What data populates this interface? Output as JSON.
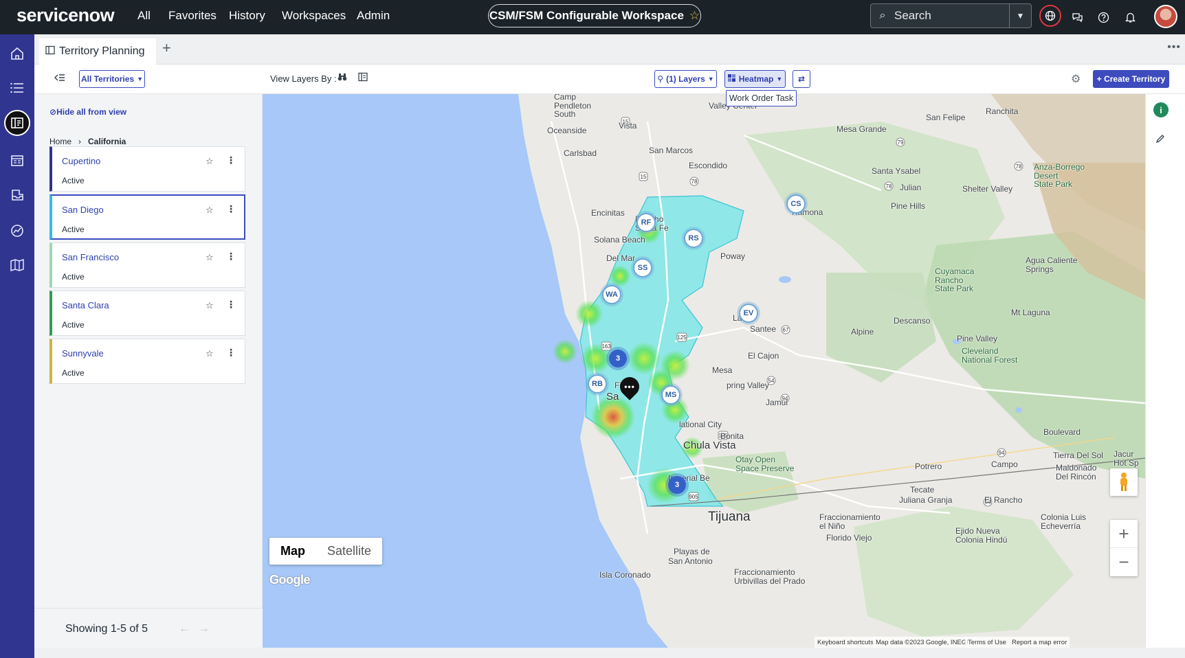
{
  "brand": "servicenow",
  "nav": {
    "all": "All",
    "favorites": "Favorites",
    "history": "History",
    "workspaces": "Workspaces",
    "admin": "Admin"
  },
  "workspace_title": "CSM/FSM Configurable Workspace",
  "search": {
    "placeholder": "Search"
  },
  "tab": {
    "label": "Territory Planning"
  },
  "toolbar": {
    "all_territories": "All Territories",
    "view_layers_by": "View Layers By :",
    "layers": "(1) Layers",
    "heatmap": "Heatmap",
    "create_territory": "+ Create Territory",
    "tooltip": "Work Order Task"
  },
  "panel": {
    "hide_all": "Hide all from view",
    "breadcrumb": {
      "home": "Home",
      "current": "California"
    },
    "territories": [
      {
        "name": "Cupertino",
        "status": "Active",
        "accent": "#30358f"
      },
      {
        "name": "San Diego",
        "status": "Active",
        "accent": "#35b9e8"
      },
      {
        "name": "San Francisco",
        "status": "Active",
        "accent": "#9ed9b0"
      },
      {
        "name": "Santa Clara",
        "status": "Active",
        "accent": "#2e9d55"
      },
      {
        "name": "Sunnyvale",
        "status": "Active",
        "accent": "#c9b63d"
      }
    ],
    "showing": "Showing 1-5 of 5"
  },
  "map": {
    "type_map": "Map",
    "type_satellite": "Satellite",
    "google": "Google",
    "attribution": {
      "shortcuts": "Keyboard shortcuts",
      "data": "Map data ©2023 Google, INEGI",
      "terms": "Terms of Use",
      "report": "Report a map error"
    },
    "markers": [
      "RF",
      "RS",
      "SS",
      "WA",
      "CS",
      "EV",
      "RB",
      "MS"
    ],
    "clusters": [
      "3",
      "3"
    ],
    "places": {
      "camp_pendleton": "Camp\nPendleton\nSouth",
      "oceanside": "Oceanside",
      "vista": "Vista",
      "carlsbad": "Carlsbad",
      "san_marcos": "San Marcos",
      "escondido": "Escondido",
      "valley_center": "Valley Center",
      "encinitas": "Encinitas",
      "rancho_santa_fe": "Rancho\nSanta Fe",
      "solana_beach": "Solana Beach",
      "del_mar": "Del Mar",
      "poway": "Poway",
      "ramona": "Ramona",
      "santee": "Santee",
      "lakeside": "Lake",
      "el_cajon": "El Cajon",
      "la_mesa": "Mesa",
      "spring_valley": "pring Valley",
      "jamul": "Jamul",
      "national_city": "lational City",
      "bonita": "Bonita",
      "chula_vista": "Chula Vista",
      "imperial_beach": "Imperial Be",
      "tijuana": "Tijuana",
      "five": "Five",
      "san_diego_partial": "Sa",
      "alpine": "Alpine",
      "descanso": "Descanso",
      "pine_valley": "Pine Valley",
      "cleveland": "Cleveland\nNational Forest",
      "mt_laguna": "Mt Laguna",
      "cuyamaca": "Cuyamaca\nRancho\nState Park",
      "agua_caliente": "Agua Caliente\nSprings",
      "anza_borrego": "Anza-Borrego\nDesert\nState Park",
      "shelter_valley": "Shelter Valley",
      "julian": "Julian",
      "santa_ysabel": "Santa Ysabel",
      "pine_hills": "Pine Hills",
      "mesa_grande": "Mesa Grande",
      "san_felipe": "San Felipe",
      "ranchita": "Ranchita",
      "springs": "Springs",
      "otay": "Otay Open\nSpace Preserve",
      "potrero": "Potrero",
      "campo": "Campo",
      "tecate": "Tecate",
      "juliana_granja": "Juliana Granja",
      "el_rancho": "El Rancho",
      "boulevard": "Boulevard",
      "tierra_del_sol": "Tierra Del Sol",
      "jacumba": "Jacur\nHot Sp",
      "maldonado": "Maldonado\nDel Rincón",
      "colonia_luis": "Colonia Luis\nEcheverría",
      "ejido_nueva": "Ejido Nueva\nColonia Hindú",
      "fracc_nino": "Fraccionamiento\nel Niño",
      "florido": "Florido Viejo",
      "rosarito_partial": "Fraccionamiento\nUrbivillas del Prado",
      "san_antonio": "San Antonio",
      "playas": "Playas de",
      "isla_coronado": "Isla Coronado"
    }
  },
  "colors": {
    "topnav": "#1b2329",
    "rail": "#30358f",
    "accent": "#3d4bbd",
    "territory_fill": "#7fe6e6"
  }
}
